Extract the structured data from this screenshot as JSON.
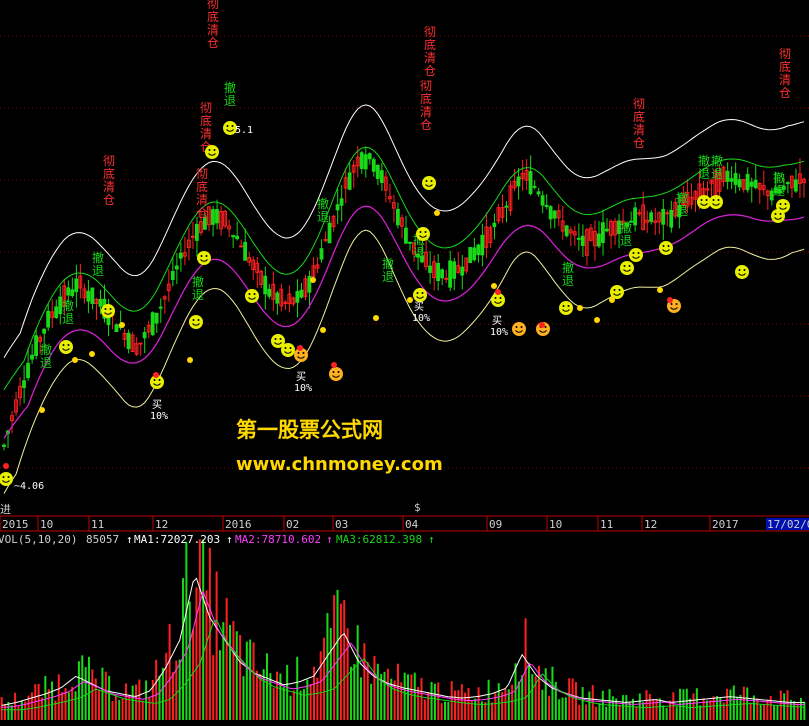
{
  "watermark": {
    "line1": "第一股票公式网",
    "line2": "www.chnmoney.com"
  },
  "colors": {
    "background": "#000000",
    "up": "#ff2020",
    "down": "#18d818",
    "upper_band": "#ffffff",
    "mid_band": "#18d818",
    "lower_band": "#d020d0",
    "axis_line": "#c00000",
    "dot": "#ffd800",
    "smiley": "#e8f000",
    "orange_smiley": "#ffb020"
  },
  "price_axis": {
    "low_label": "~4.06",
    "high_label": "5.1"
  },
  "date_axis": {
    "left_label": "进",
    "labels": [
      "2015",
      "10",
      "11",
      "12",
      "2016",
      "02",
      "03",
      "04",
      "09",
      "10",
      "11",
      "12",
      "2017"
    ],
    "current_date": "17/02/0",
    "marker": "$"
  },
  "volume_header": {
    "name": "VOL(5,10,20)",
    "value": "85057",
    "ma1_label": "MA1:72027.203",
    "ma2_label": "MA2:78710.602",
    "ma3_label": "MA3:62812.398",
    "arrow": "↑"
  },
  "signals": {
    "clear_text": "彻底清仓",
    "retreat_text": "撤退",
    "buy_text": "买",
    "pct_text": "10%"
  },
  "chart_data": {
    "type": "candlestick",
    "series": [
      {
        "name": "VOL(5,10,20)"
      },
      {
        "name": "MA1"
      },
      {
        "name": "MA2"
      },
      {
        "name": "MA3"
      }
    ],
    "price_close": [
      4.06,
      4.25,
      4.4,
      4.52,
      4.6,
      4.65,
      4.6,
      4.55,
      4.48,
      4.42,
      4.5,
      4.62,
      4.75,
      4.85,
      4.9,
      4.88,
      4.8,
      4.7,
      4.62,
      4.58,
      4.6,
      4.7,
      4.85,
      5.0,
      5.12,
      5.1,
      4.98,
      4.85,
      4.75,
      4.7,
      4.68,
      4.72,
      4.78,
      4.85,
      4.95,
      5.05,
      5.0,
      4.92,
      4.85,
      4.8,
      4.82,
      4.86,
      4.88,
      4.9,
      4.88,
      4.9,
      4.95,
      4.98,
      5.02,
      5.05,
      5.02,
      5.0,
      4.98,
      5.01,
      5.04
    ],
    "volume_relative": [
      0.1,
      0.12,
      0.15,
      0.18,
      0.22,
      0.3,
      0.25,
      0.2,
      0.18,
      0.16,
      0.2,
      0.35,
      0.55,
      1.0,
      0.7,
      0.55,
      0.4,
      0.32,
      0.28,
      0.24,
      0.26,
      0.3,
      0.45,
      0.6,
      0.4,
      0.3,
      0.25,
      0.22,
      0.2,
      0.18,
      0.16,
      0.15,
      0.16,
      0.18,
      0.22,
      0.45,
      0.3,
      0.22,
      0.18,
      0.15,
      0.14,
      0.13,
      0.12,
      0.13,
      0.14,
      0.12,
      0.13,
      0.14,
      0.15,
      0.16,
      0.15,
      0.14,
      0.13,
      0.12,
      0.12
    ]
  }
}
